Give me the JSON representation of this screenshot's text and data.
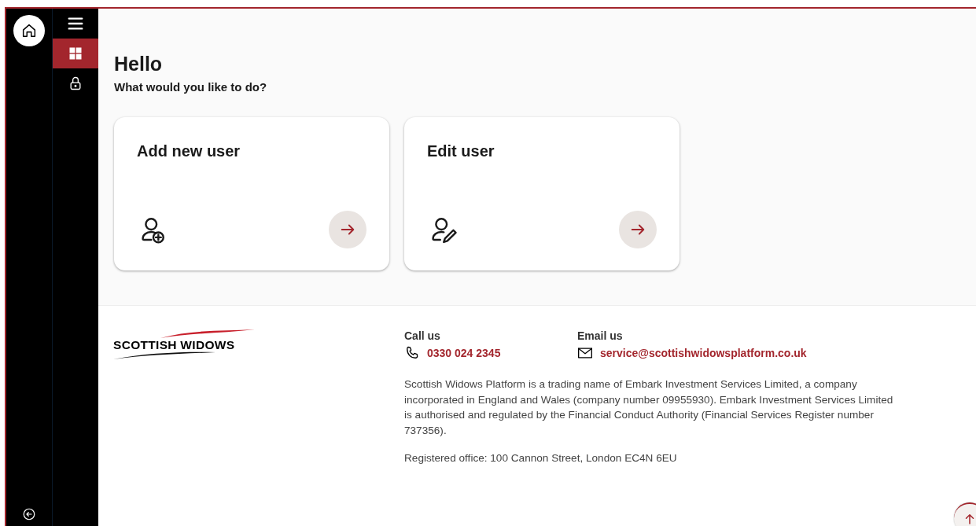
{
  "rail": {
    "items": [
      {
        "kind": "home"
      }
    ],
    "bottom": {
      "kind": "back"
    }
  },
  "nav": {
    "items": [
      {
        "kind": "menu",
        "selected": false
      },
      {
        "kind": "dashboard",
        "selected": true
      },
      {
        "kind": "lock",
        "selected": false
      }
    ]
  },
  "heading": "Hello",
  "subheading": "What would you like to do?",
  "cards": [
    {
      "title": "Add new user",
      "kind": "add"
    },
    {
      "title": "Edit user",
      "kind": "edit"
    }
  ],
  "footer": {
    "logo": "SCOTTISH WIDOWS",
    "contacts": [
      {
        "label": "Call us",
        "value": "0330 024 2345",
        "kind": "phone"
      },
      {
        "label": "Email us",
        "value": "service@scottishwidowsplatform.co.uk",
        "kind": "email"
      }
    ],
    "disclaimer": "Scottish Widows Platform is a trading name of Embark Investment Services Limited, a company incorporated in England and Wales (company number 09955930). Embark Investment Services Limited is authorised and regulated by the Financial Conduct Authority (Financial Services Register number 737356).",
    "office": "Registered office: 100 Cannon Street, London EC4N 6EU"
  }
}
